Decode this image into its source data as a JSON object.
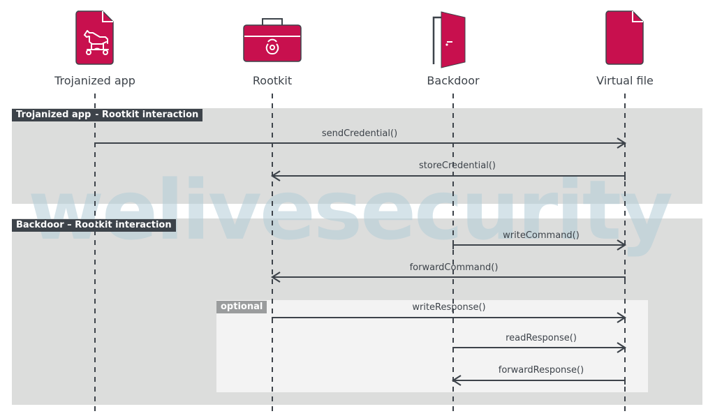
{
  "actors": [
    {
      "id": "trojan",
      "label": "Trojanized app",
      "icon": "trojan-horse-file-icon"
    },
    {
      "id": "rootkit",
      "label": "Rootkit",
      "icon": "biohazard-toolbox-icon"
    },
    {
      "id": "backdoor",
      "label": "Backdoor",
      "icon": "open-door-icon"
    },
    {
      "id": "vfile",
      "label": "Virtual file",
      "icon": "file-icon"
    }
  ],
  "sections": [
    {
      "label": "Trojanized app – Rootkit interaction"
    },
    {
      "label": "Backdoor – Rootkit interaction"
    }
  ],
  "optional_fragment": {
    "label": "optional"
  },
  "messages": [
    {
      "label": "sendCredential()",
      "from": "trojan",
      "to": "vfile"
    },
    {
      "label": "storeCredential()",
      "from": "vfile",
      "to": "rootkit"
    },
    {
      "label": "writeCommand()",
      "from": "backdoor",
      "to": "vfile"
    },
    {
      "label": "forwardCommand()",
      "from": "vfile",
      "to": "rootkit"
    },
    {
      "label": "writeResponse()",
      "from": "rootkit",
      "to": "vfile"
    },
    {
      "label": "readResponse()",
      "from": "backdoor",
      "to": "vfile"
    },
    {
      "label": "forwardResponse()",
      "from": "vfile",
      "to": "backdoor"
    }
  ],
  "watermark": "welivesecurity",
  "colors": {
    "accent": "#c8104e",
    "dark": "#3d434a",
    "section_bg": "#dcdddc",
    "optional_bg": "#f3f3f3",
    "tag_bg": "#3d434a",
    "optional_tag_bg": "#9a9c9d"
  }
}
